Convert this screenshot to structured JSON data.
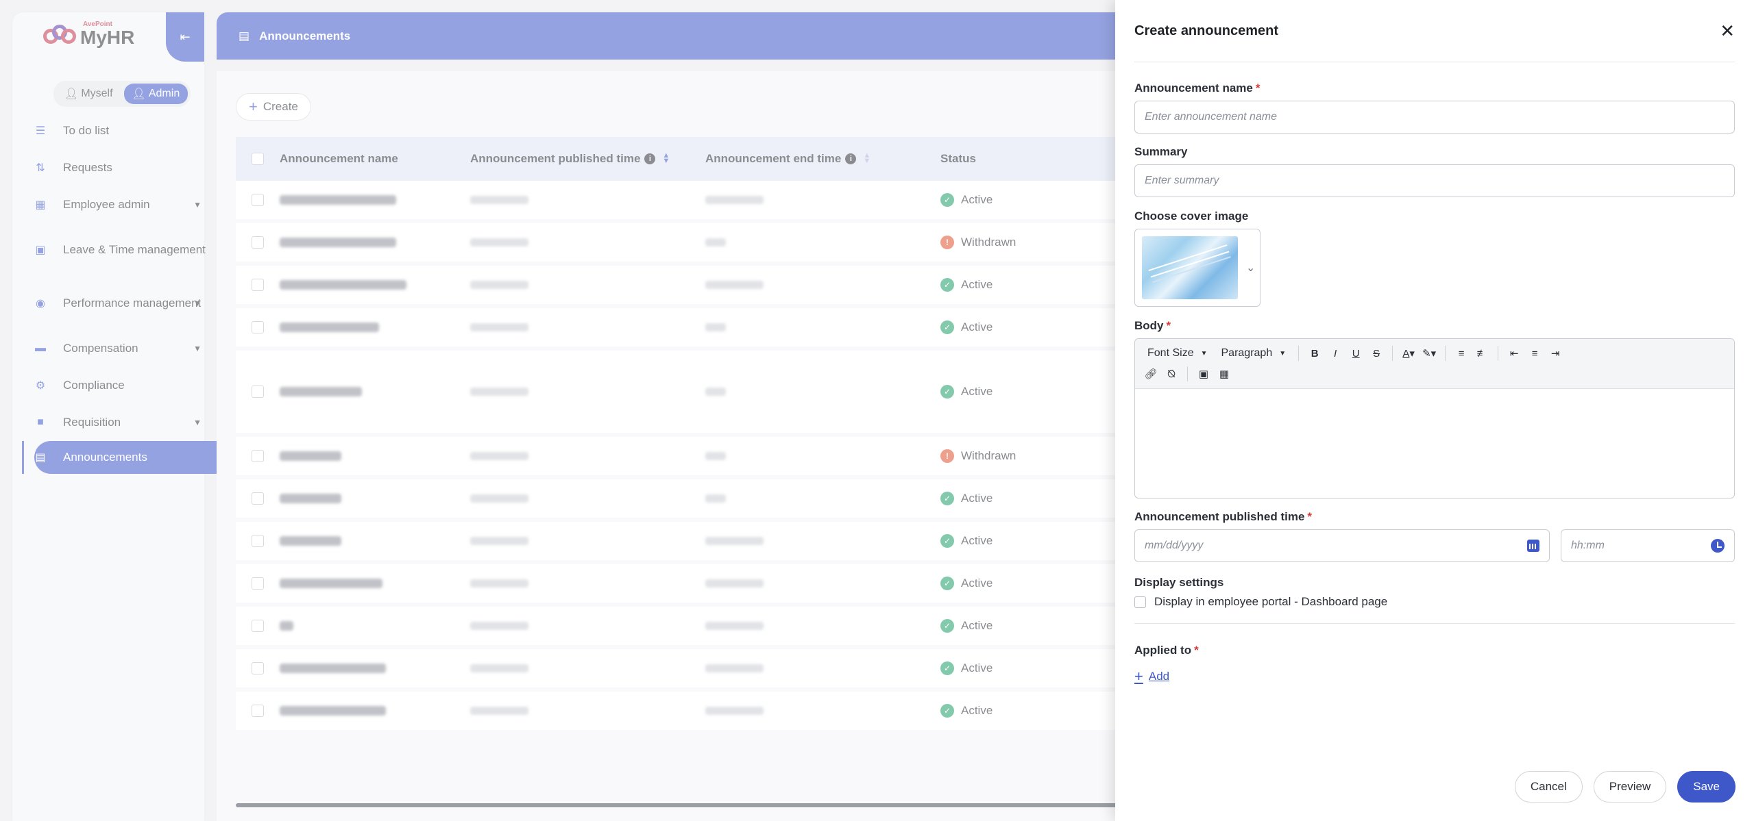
{
  "app": {
    "logo_sub": "AvePoint",
    "logo_main": "MyHR"
  },
  "role_switch": {
    "myself": "Myself",
    "admin": "Admin"
  },
  "sidebar": {
    "items": [
      {
        "label": "To do list",
        "icon": "list-icon",
        "caret": false
      },
      {
        "label": "Requests",
        "icon": "requests-icon",
        "caret": false
      },
      {
        "label": "Employee admin",
        "icon": "employee-badge-icon",
        "caret": true
      },
      {
        "label": "Leave & Time management",
        "icon": "calendar-icon",
        "caret": false
      },
      {
        "label": "Performance management",
        "icon": "binoculars-icon",
        "caret": true
      },
      {
        "label": "Compensation",
        "icon": "wallet-icon",
        "caret": true
      },
      {
        "label": "Compliance",
        "icon": "shield-gear-icon",
        "caret": false
      },
      {
        "label": "Requisition",
        "icon": "briefcase-icon",
        "caret": true
      },
      {
        "label": "Announcements",
        "icon": "newspaper-icon",
        "caret": false,
        "active": true
      }
    ]
  },
  "header": {
    "title": "Announcements"
  },
  "toolbar": {
    "create_label": "Create"
  },
  "table": {
    "columns": [
      "Announcement name",
      "Announcement published time",
      "Announcement end time",
      "Status"
    ],
    "rows": [
      {
        "status": "Active"
      },
      {
        "status": "Withdrawn"
      },
      {
        "status": "Active"
      },
      {
        "status": "Active"
      },
      {
        "status": "Active"
      },
      {
        "status": "Withdrawn"
      },
      {
        "status": "Active"
      },
      {
        "status": "Active"
      },
      {
        "status": "Active"
      },
      {
        "status": "Active"
      },
      {
        "status": "Active"
      },
      {
        "status": "Active"
      }
    ]
  },
  "panel": {
    "title": "Create announcement",
    "name_label": "Announcement name",
    "name_placeholder": "Enter announcement name",
    "summary_label": "Summary",
    "summary_placeholder": "Enter summary",
    "cover_label": "Choose cover image",
    "body_label": "Body",
    "editor": {
      "font_size": "Font Size",
      "paragraph": "Paragraph"
    },
    "published_label": "Announcement published time",
    "date_placeholder": "mm/dd/yyyy",
    "time_placeholder": "hh:mm",
    "display_label": "Display settings",
    "display_checkbox": "Display in employee portal - Dashboard page",
    "applied_label": "Applied to",
    "add_label": "Add",
    "cancel": "Cancel",
    "preview": "Preview",
    "save": "Save"
  },
  "colors": {
    "accent": "#3e57c9",
    "active": "#1e9e6a",
    "withdrawn": "#e0532f",
    "required": "#d63b3b"
  }
}
